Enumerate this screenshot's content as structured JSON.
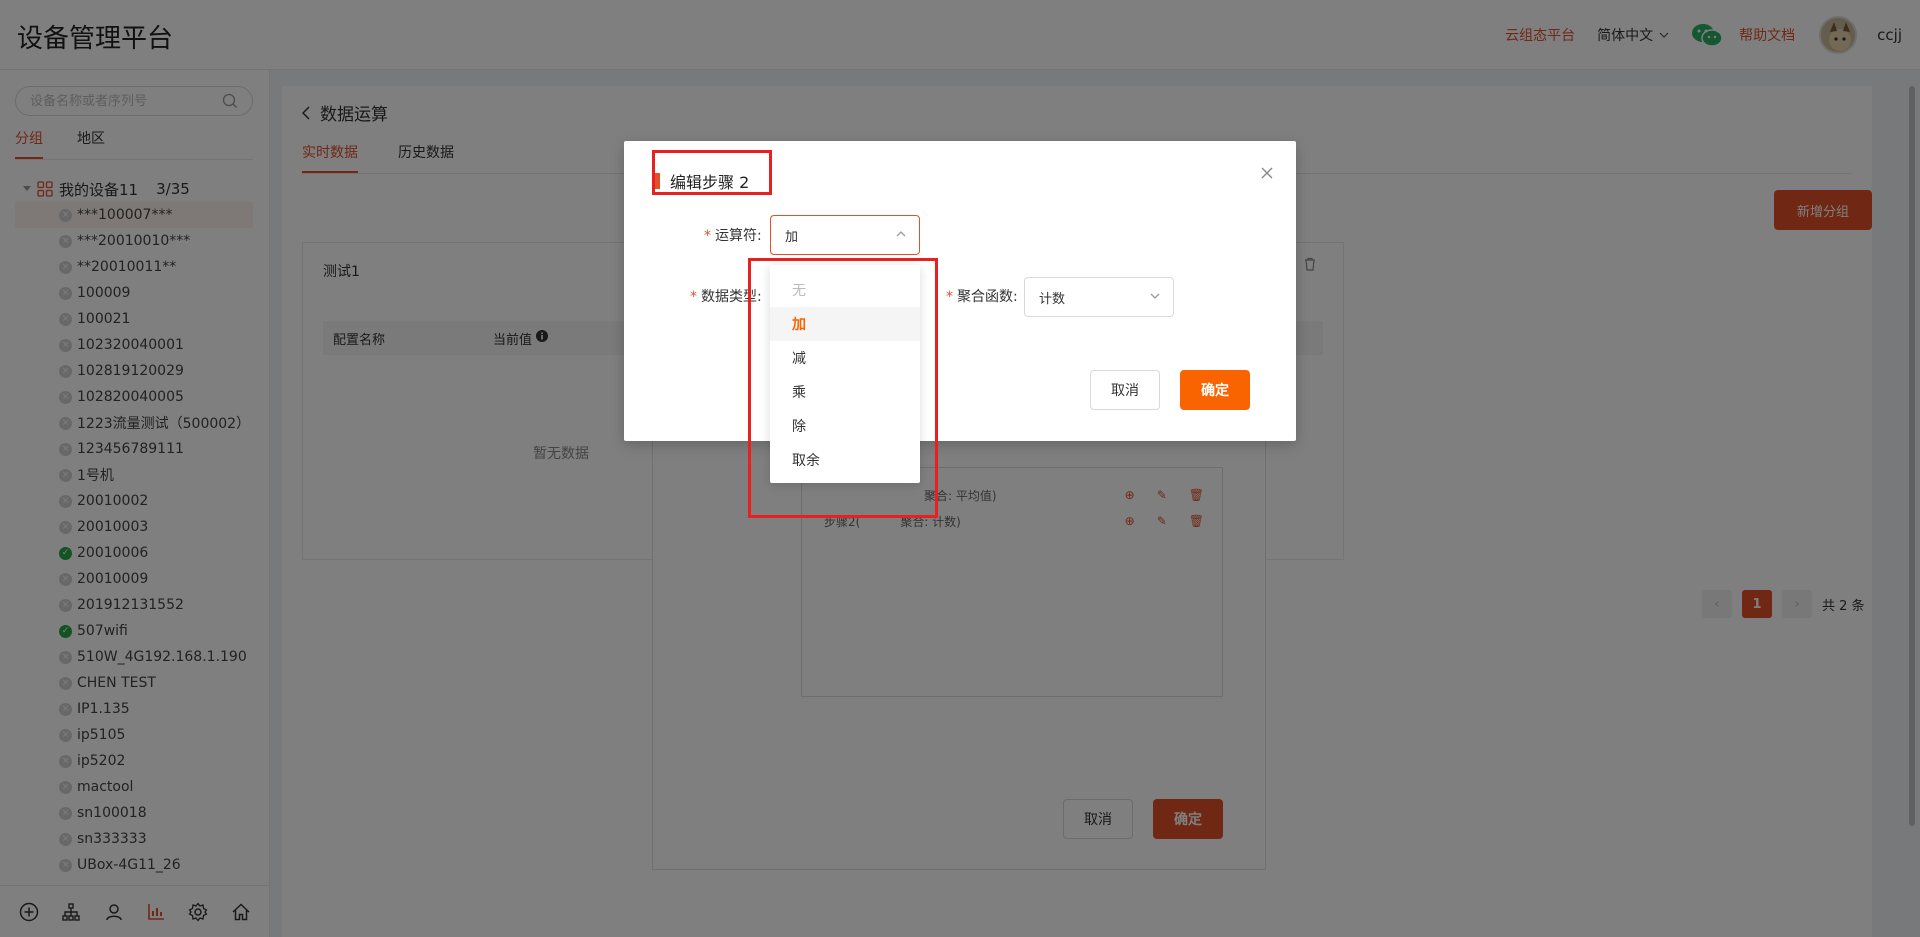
{
  "header": {
    "title": "设备管理平台",
    "link_cloud": "云组态平台",
    "language": "简体中文",
    "help": "帮助文档",
    "user": "ccjj"
  },
  "sidebar": {
    "search_placeholder": "设备名称或者序列号",
    "tabs": [
      "分组",
      "地区"
    ],
    "root": {
      "label": "我的设备11",
      "count": "3/35"
    },
    "items": [
      {
        "label": "***100007***",
        "online": false
      },
      {
        "label": "***20010010***",
        "online": false
      },
      {
        "label": "**20010011**",
        "online": false
      },
      {
        "label": "100009",
        "online": false
      },
      {
        "label": "100021",
        "online": false
      },
      {
        "label": "102320040001",
        "online": false
      },
      {
        "label": "102819120029",
        "online": false
      },
      {
        "label": "102820040005",
        "online": false
      },
      {
        "label": "1223流量测试（500002）",
        "online": false
      },
      {
        "label": "123456789111",
        "online": false
      },
      {
        "label": "1号机",
        "online": false
      },
      {
        "label": "20010002",
        "online": false
      },
      {
        "label": "20010003",
        "online": false
      },
      {
        "label": "20010006",
        "online": true
      },
      {
        "label": "20010009",
        "online": false
      },
      {
        "label": "201912131552",
        "online": false
      },
      {
        "label": "507wifi",
        "online": true
      },
      {
        "label": "510W_4G192.168.1.190",
        "online": false
      },
      {
        "label": "CHEN TEST",
        "online": false
      },
      {
        "label": "IP1.135",
        "online": false
      },
      {
        "label": "ip5105",
        "online": false
      },
      {
        "label": "ip5202",
        "online": false
      },
      {
        "label": "mactool",
        "online": false
      },
      {
        "label": "sn100018",
        "online": false
      },
      {
        "label": "sn333333",
        "online": false
      },
      {
        "label": "UBox-4G11_26",
        "online": false
      }
    ]
  },
  "main": {
    "title": "数据运算",
    "tabs": [
      "实时数据",
      "历史数据"
    ],
    "add_group": "新增分组",
    "card_title": "测试1",
    "col_name": "配置名称",
    "col_value": "当前值",
    "empty": "暂无数据",
    "pager_current": "1",
    "pager_total": "共 2 条"
  },
  "inner_dialog": {
    "step1_text": "聚合: 平均值)",
    "step2_text": "步骤2(",
    "step2_text_tail": "聚合: 计数)",
    "cancel": "取消",
    "ok": "确定"
  },
  "modal": {
    "title": "编辑步骤 2",
    "operator_label": "运算符:",
    "operator_value": "加",
    "data_type_label": "数据类型:",
    "agg_label": "聚合函数:",
    "agg_value": "计数",
    "cancel": "取消",
    "ok": "确定",
    "options": [
      "无",
      "加",
      "减",
      "乘",
      "除",
      "取余"
    ]
  }
}
